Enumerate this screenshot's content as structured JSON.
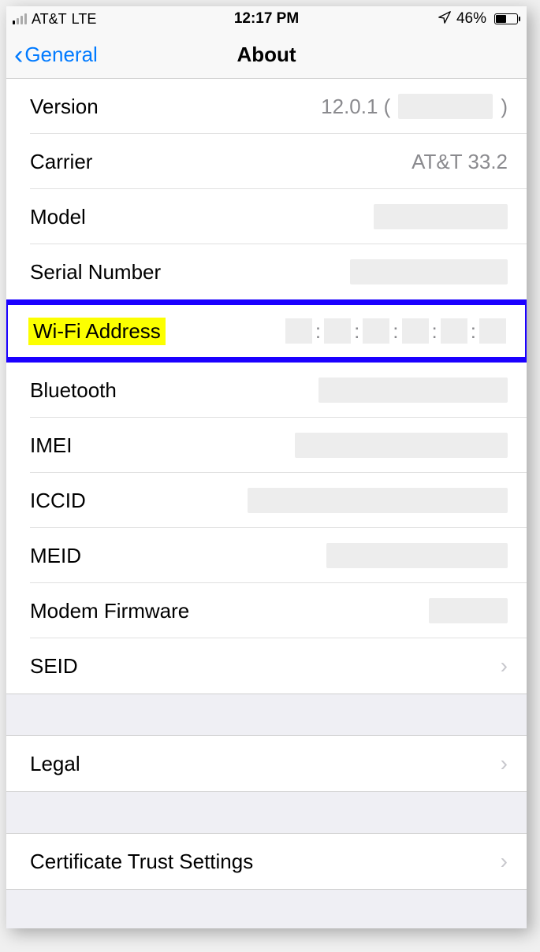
{
  "statusBar": {
    "carrier": "AT&T",
    "network": "LTE",
    "time": "12:17 PM",
    "batteryPercent": "46%"
  },
  "nav": {
    "back": "General",
    "title": "About"
  },
  "rows": {
    "version": {
      "label": "Version",
      "valuePrefix": "12.0.1 (",
      "valueSuffix": ")"
    },
    "carrier": {
      "label": "Carrier",
      "value": "AT&T 33.2"
    },
    "model": {
      "label": "Model"
    },
    "serial": {
      "label": "Serial Number"
    },
    "wifi": {
      "label": "Wi-Fi Address",
      "sep": ":"
    },
    "bluetooth": {
      "label": "Bluetooth"
    },
    "imei": {
      "label": "IMEI"
    },
    "iccid": {
      "label": "ICCID"
    },
    "meid": {
      "label": "MEID"
    },
    "modem": {
      "label": "Modem Firmware"
    },
    "seid": {
      "label": "SEID"
    },
    "legal": {
      "label": "Legal"
    },
    "cert": {
      "label": "Certificate Trust Settings"
    }
  }
}
